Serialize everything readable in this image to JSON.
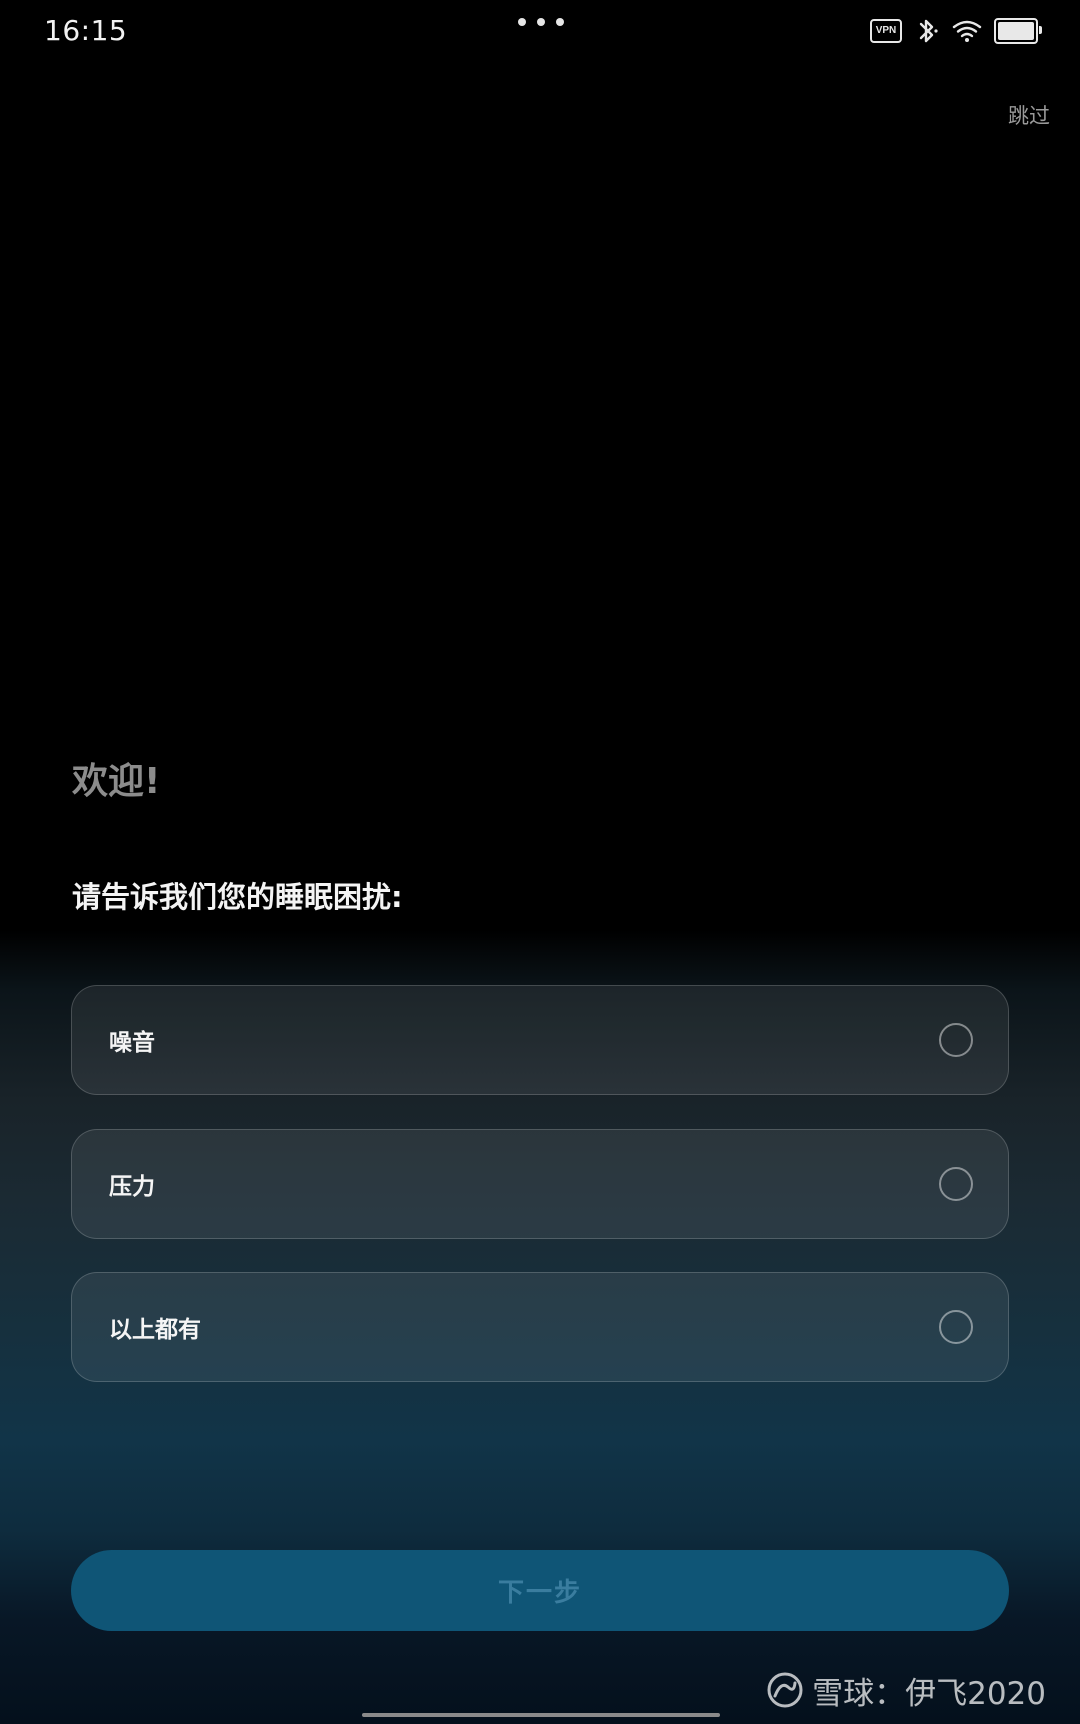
{
  "status_bar": {
    "time": "16:15",
    "vpn_label": "VPN",
    "icons": [
      "more-dots-icon",
      "vpn-icon",
      "bluetooth-icon",
      "wifi-icon",
      "battery-icon"
    ]
  },
  "header": {
    "skip_label": "跳过"
  },
  "main": {
    "welcome": "欢迎!",
    "question": "请告诉我们您的睡眠困扰:",
    "options": [
      {
        "label": "噪音",
        "selected": false
      },
      {
        "label": "压力",
        "selected": false
      },
      {
        "label": "以上都有",
        "selected": false
      }
    ],
    "next_label": "下一步"
  },
  "watermark": {
    "text": "雪球：伊飞2020"
  },
  "colors": {
    "accent_button": "#0f5576",
    "button_text_disabled": "#3a7d9f",
    "background": "#000000"
  }
}
